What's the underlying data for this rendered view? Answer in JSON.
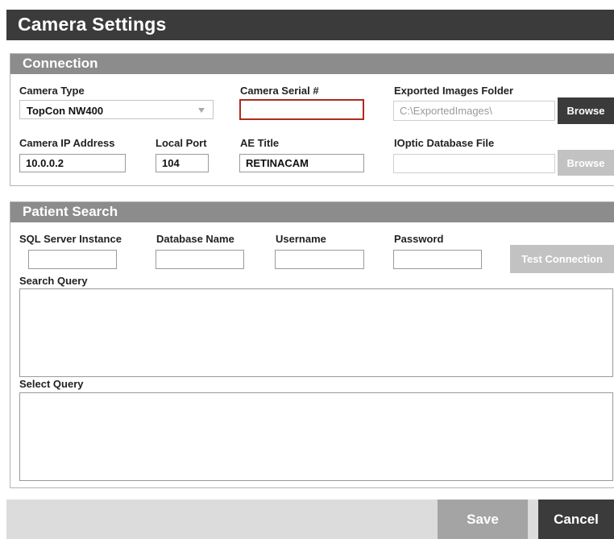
{
  "window": {
    "title": "Camera Settings"
  },
  "connection": {
    "header": "Connection",
    "camera_type": {
      "label": "Camera Type",
      "value": "TopCon NW400"
    },
    "camera_serial": {
      "label": "Camera Serial #",
      "value": ""
    },
    "exported_images": {
      "label": "Exported Images Folder",
      "value": "C:\\ExportedImages\\",
      "browse_label": "Browse"
    },
    "camera_ip": {
      "label": "Camera IP Address",
      "value": "10.0.0.2"
    },
    "local_port": {
      "label": "Local Port",
      "value": "104"
    },
    "ae_title": {
      "label": "AE Title",
      "value": "RETINACAM"
    },
    "ioptic_db": {
      "label": "IOptic Database File",
      "value": "",
      "browse_label": "Browse"
    }
  },
  "patient_search": {
    "header": "Patient Search",
    "sql_server": {
      "label": "SQL Server Instance",
      "value": ""
    },
    "database_name": {
      "label": "Database Name",
      "value": ""
    },
    "username": {
      "label": "Username",
      "value": ""
    },
    "password": {
      "label": "Password",
      "value": ""
    },
    "test_connection_label": "Test Connection",
    "search_query": {
      "label": "Search Query",
      "value": ""
    },
    "select_query": {
      "label": "Select Query",
      "value": ""
    }
  },
  "footer": {
    "save_label": "Save",
    "cancel_label": "Cancel"
  },
  "colors": {
    "title_bar": "#3b3b3b",
    "panel_header": "#8c8c8c",
    "error_border": "#b02a1e",
    "disabled_button": "#c2c2c2",
    "footer_bg": "#dcdcdc"
  }
}
